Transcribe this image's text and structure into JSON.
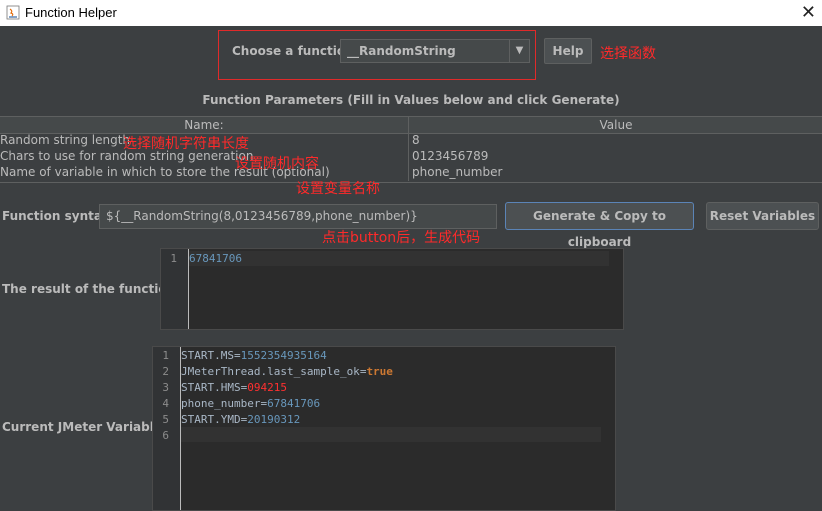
{
  "window": {
    "title": "Function Helper"
  },
  "chooser": {
    "label": "Choose a function",
    "selected": "__RandomString",
    "help_label": "Help",
    "annotation": "选择函数"
  },
  "params": {
    "title": "Function Parameters (Fill in Values below and click Generate)",
    "columns": [
      "Name:",
      "Value"
    ],
    "rows": [
      {
        "name": "Random string length",
        "value": "8",
        "annotation": "选择随机字符串长度"
      },
      {
        "name": "Chars to use for random string generation",
        "value": "0123456789",
        "annotation": "设置随机内容"
      },
      {
        "name": "Name of variable in which to store the result (optional)",
        "value": "phone_number",
        "annotation": "设置变量名称"
      }
    ]
  },
  "syntax": {
    "label": "Function syntax:",
    "value": "${__RandomString(8,0123456789,phone_number)}",
    "generate_label": "Generate & Copy to clipboard",
    "reset_label": "Reset Variables",
    "annotation": "点击button后，生成代码"
  },
  "result": {
    "label": "The result of the function is",
    "line_number": "1",
    "value": "67841706"
  },
  "variables": {
    "label": "Current JMeter Variables",
    "lines": [
      {
        "n": "1",
        "key": "START.MS",
        "val": "1552354935164"
      },
      {
        "n": "2",
        "key": "JMeterThread.last_sample_ok",
        "val": "true"
      },
      {
        "n": "3",
        "key": "START.HMS",
        "val": "094215"
      },
      {
        "n": "4",
        "key": "phone_number",
        "val": "67841706"
      },
      {
        "n": "5",
        "key": "START.YMD",
        "val": "20190312"
      },
      {
        "n": "6",
        "key": "",
        "val": ""
      }
    ]
  },
  "colors": {
    "background": "#3c3f41",
    "annotation": "#ff2a2a",
    "number": "#6897bb",
    "keyword": "#cc7832",
    "highlight_value": "#ff3030"
  }
}
